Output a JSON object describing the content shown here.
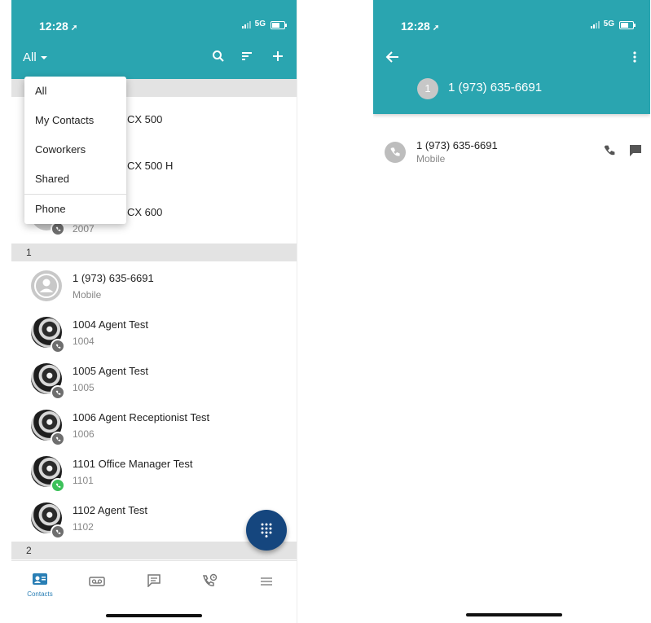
{
  "left_screen": {
    "status_bar": {
      "time": "12:28",
      "network": "5G"
    },
    "filter_label": "All",
    "filter_menu": {
      "items": [
        "All",
        "My Contacts",
        "Coworkers",
        "Shared",
        "Phone"
      ]
    },
    "sections": [
      {
        "header": "1",
        "contacts": [
          {
            "name": "CX 500",
            "sub": ""
          },
          {
            "name": "CX 500 H",
            "sub": ""
          },
          {
            "name": "CX 600",
            "sub": "2007"
          }
        ]
      },
      {
        "header": "1",
        "contacts": [
          {
            "name": "1 (973) 635-6691",
            "sub": "Mobile"
          },
          {
            "name": "1004 Agent Test",
            "sub": "1004"
          },
          {
            "name": "1005 Agent Test",
            "sub": "1005"
          },
          {
            "name": "1006 Agent Receptionist Test",
            "sub": "1006"
          },
          {
            "name": "1101 Office Manager Test",
            "sub": "1101"
          },
          {
            "name": "1102 Agent Test",
            "sub": "1102"
          }
        ]
      },
      {
        "header": "2",
        "contacts": []
      }
    ],
    "bottom_nav": {
      "contacts_label": "Contacts"
    },
    "colors": {
      "header_teal": "#2aa5b0",
      "fab_navy": "#15467e",
      "presence_green": "#3cc15a",
      "nav_accent": "#2a7fb5"
    }
  },
  "right_screen": {
    "status_bar": {
      "time": "12:28",
      "network": "5G"
    },
    "header": {
      "avatar_initial": "1",
      "title": "1 (973) 635-6691"
    },
    "numbers": [
      {
        "number": "1 (973) 635-6691",
        "type": "Mobile"
      }
    ]
  }
}
